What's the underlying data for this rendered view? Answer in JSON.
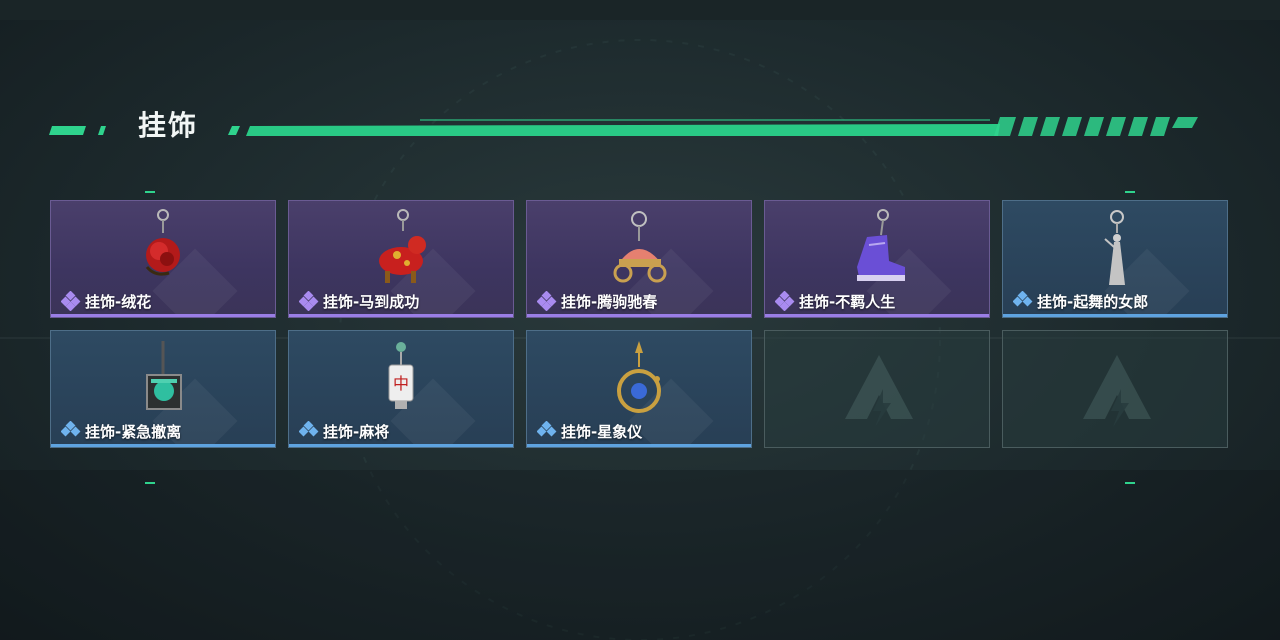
{
  "section": {
    "title": "挂饰"
  },
  "items": [
    {
      "label": "挂饰-绒花",
      "rarity": "purple",
      "icon": "rose-charm-icon"
    },
    {
      "label": "挂饰-马到成功",
      "rarity": "purple",
      "icon": "horse-charm-icon"
    },
    {
      "label": "挂饰-腾驹驰春",
      "rarity": "purple",
      "icon": "carriage-charm-icon"
    },
    {
      "label": "挂饰-不羁人生",
      "rarity": "purple",
      "icon": "sneaker-charm-icon"
    },
    {
      "label": "挂饰-起舞的女郎",
      "rarity": "blue",
      "icon": "dancer-charm-icon"
    },
    {
      "label": "挂饰-紧急撤离",
      "rarity": "blue",
      "icon": "emergency-tag-charm-icon"
    },
    {
      "label": "挂饰-麻将",
      "rarity": "blue",
      "icon": "mahjong-charm-icon"
    },
    {
      "label": "挂饰-星象仪",
      "rarity": "blue",
      "icon": "orrery-charm-icon"
    },
    {
      "label": "",
      "rarity": "empty",
      "icon": "empty-slot-logo-icon"
    },
    {
      "label": "",
      "rarity": "empty",
      "icon": "empty-slot-logo-icon"
    }
  ],
  "colors": {
    "accent_green": "#2fd38d",
    "purple_rarity": "#9a7ee6",
    "blue_rarity": "#5ea3e0"
  }
}
